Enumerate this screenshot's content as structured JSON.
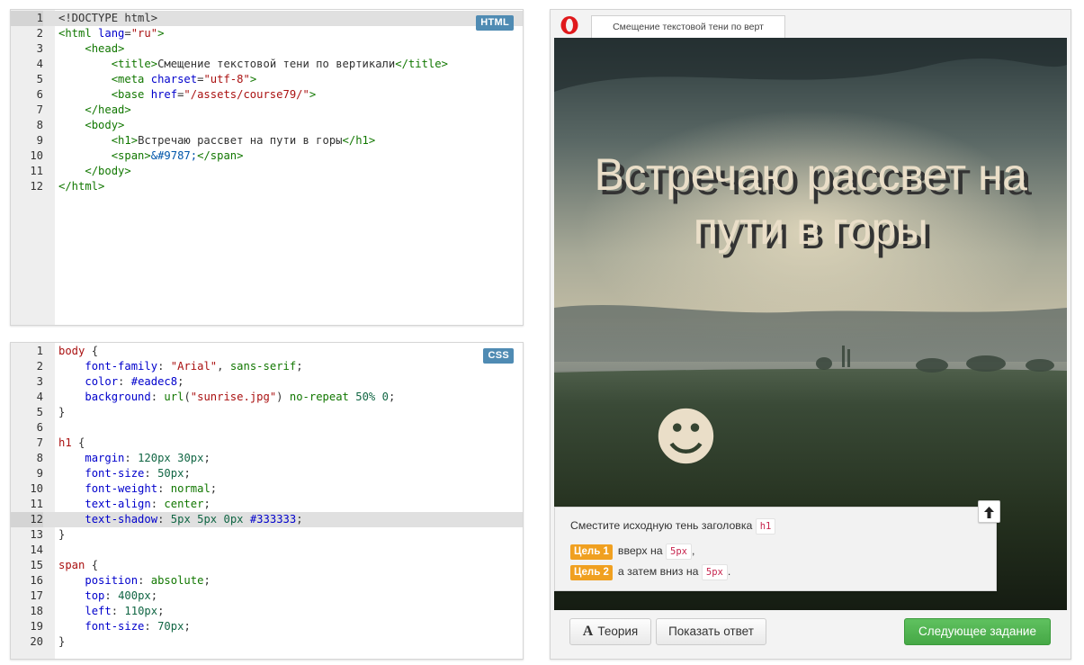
{
  "html_editor": {
    "badge": "HTML",
    "lines": [
      {
        "n": "1",
        "t": [
          [
            "plain",
            "<!DOCTYPE html>"
          ]
        ]
      },
      {
        "n": "2",
        "t": [
          [
            "tag",
            "<html"
          ],
          [
            "attr",
            " lang"
          ],
          [
            "plain",
            "="
          ],
          [
            "str",
            "\"ru\""
          ],
          [
            "tag",
            ">"
          ]
        ]
      },
      {
        "n": "3",
        "t": [
          [
            "plain",
            "    "
          ],
          [
            "tag",
            "<head>"
          ]
        ]
      },
      {
        "n": "4",
        "t": [
          [
            "plain",
            "        "
          ],
          [
            "tag",
            "<title>"
          ],
          [
            "plain",
            "Смещение текстовой тени по вертикали"
          ],
          [
            "tag",
            "</title>"
          ]
        ]
      },
      {
        "n": "5",
        "t": [
          [
            "plain",
            "        "
          ],
          [
            "tag",
            "<meta"
          ],
          [
            "attr",
            " charset"
          ],
          [
            "plain",
            "="
          ],
          [
            "str",
            "\"utf-8\""
          ],
          [
            "tag",
            ">"
          ]
        ]
      },
      {
        "n": "6",
        "t": [
          [
            "plain",
            "        "
          ],
          [
            "tag",
            "<base"
          ],
          [
            "attr",
            " href"
          ],
          [
            "plain",
            "="
          ],
          [
            "str",
            "\"/assets/course79/\""
          ],
          [
            "tag",
            ">"
          ]
        ]
      },
      {
        "n": "7",
        "t": [
          [
            "plain",
            "    "
          ],
          [
            "tag",
            "</head>"
          ]
        ]
      },
      {
        "n": "8",
        "t": [
          [
            "plain",
            "    "
          ],
          [
            "tag",
            "<body>"
          ]
        ]
      },
      {
        "n": "9",
        "t": [
          [
            "plain",
            "        "
          ],
          [
            "tag",
            "<h1>"
          ],
          [
            "plain",
            "Встречаю рассвет на пути в горы"
          ],
          [
            "tag",
            "</h1>"
          ]
        ]
      },
      {
        "n": "10",
        "t": [
          [
            "plain",
            "        "
          ],
          [
            "tag",
            "<span>"
          ],
          [
            "ent",
            "&#9787;"
          ],
          [
            "tag",
            "</span>"
          ]
        ]
      },
      {
        "n": "11",
        "t": [
          [
            "plain",
            "    "
          ],
          [
            "tag",
            "</body>"
          ]
        ]
      },
      {
        "n": "12",
        "t": [
          [
            "tag",
            "</html>"
          ]
        ]
      }
    ],
    "active_line": "1"
  },
  "css_editor": {
    "badge": "CSS",
    "lines": [
      {
        "n": "1",
        "t": [
          [
            "sel",
            "body"
          ],
          [
            "plain",
            " {"
          ]
        ]
      },
      {
        "n": "2",
        "t": [
          [
            "plain",
            "    "
          ],
          [
            "prop",
            "font-family"
          ],
          [
            "plain",
            ": "
          ],
          [
            "str",
            "\"Arial\""
          ],
          [
            "plain",
            ", "
          ],
          [
            "val",
            "sans-serif"
          ],
          [
            "plain",
            ";"
          ]
        ]
      },
      {
        "n": "3",
        "t": [
          [
            "plain",
            "    "
          ],
          [
            "prop",
            "color"
          ],
          [
            "plain",
            ": "
          ],
          [
            "attr",
            "#eadec8"
          ],
          [
            "plain",
            ";"
          ]
        ]
      },
      {
        "n": "4",
        "t": [
          [
            "plain",
            "    "
          ],
          [
            "prop",
            "background"
          ],
          [
            "plain",
            ": "
          ],
          [
            "val",
            "url"
          ],
          [
            "plain",
            "("
          ],
          [
            "str",
            "\"sunrise.jpg\""
          ],
          [
            "plain",
            ") "
          ],
          [
            "val",
            "no-repeat"
          ],
          [
            "plain",
            " "
          ],
          [
            "num",
            "50%"
          ],
          [
            "plain",
            " "
          ],
          [
            "num",
            "0"
          ],
          [
            "plain",
            ";"
          ]
        ]
      },
      {
        "n": "5",
        "t": [
          [
            "plain",
            "}"
          ]
        ]
      },
      {
        "n": "6",
        "t": [
          [
            "plain",
            ""
          ]
        ]
      },
      {
        "n": "7",
        "t": [
          [
            "sel",
            "h1"
          ],
          [
            "plain",
            " {"
          ]
        ]
      },
      {
        "n": "8",
        "t": [
          [
            "plain",
            "    "
          ],
          [
            "prop",
            "margin"
          ],
          [
            "plain",
            ": "
          ],
          [
            "num",
            "120px"
          ],
          [
            "plain",
            " "
          ],
          [
            "num",
            "30px"
          ],
          [
            "plain",
            ";"
          ]
        ]
      },
      {
        "n": "9",
        "t": [
          [
            "plain",
            "    "
          ],
          [
            "prop",
            "font-size"
          ],
          [
            "plain",
            ": "
          ],
          [
            "num",
            "50px"
          ],
          [
            "plain",
            ";"
          ]
        ]
      },
      {
        "n": "10",
        "t": [
          [
            "plain",
            "    "
          ],
          [
            "prop",
            "font-weight"
          ],
          [
            "plain",
            ": "
          ],
          [
            "val",
            "normal"
          ],
          [
            "plain",
            ";"
          ]
        ]
      },
      {
        "n": "11",
        "t": [
          [
            "plain",
            "    "
          ],
          [
            "prop",
            "text-align"
          ],
          [
            "plain",
            ": "
          ],
          [
            "val",
            "center"
          ],
          [
            "plain",
            ";"
          ]
        ]
      },
      {
        "n": "12",
        "t": [
          [
            "plain",
            "    "
          ],
          [
            "prop",
            "text-shadow"
          ],
          [
            "plain",
            ": "
          ],
          [
            "num",
            "5px"
          ],
          [
            "plain",
            " "
          ],
          [
            "num",
            "5px"
          ],
          [
            "plain",
            " "
          ],
          [
            "num",
            "0px"
          ],
          [
            "plain",
            " "
          ],
          [
            "attr",
            "#333333"
          ],
          [
            "plain",
            ";"
          ]
        ]
      },
      {
        "n": "13",
        "t": [
          [
            "plain",
            "}"
          ]
        ]
      },
      {
        "n": "14",
        "t": [
          [
            "plain",
            ""
          ]
        ]
      },
      {
        "n": "15",
        "t": [
          [
            "sel",
            "span"
          ],
          [
            "plain",
            " {"
          ]
        ]
      },
      {
        "n": "16",
        "t": [
          [
            "plain",
            "    "
          ],
          [
            "prop",
            "position"
          ],
          [
            "plain",
            ": "
          ],
          [
            "val",
            "absolute"
          ],
          [
            "plain",
            ";"
          ]
        ]
      },
      {
        "n": "17",
        "t": [
          [
            "plain",
            "    "
          ],
          [
            "prop",
            "top"
          ],
          [
            "plain",
            ": "
          ],
          [
            "num",
            "400px"
          ],
          [
            "plain",
            ";"
          ]
        ]
      },
      {
        "n": "18",
        "t": [
          [
            "plain",
            "    "
          ],
          [
            "prop",
            "left"
          ],
          [
            "plain",
            ": "
          ],
          [
            "num",
            "110px"
          ],
          [
            "plain",
            ";"
          ]
        ]
      },
      {
        "n": "19",
        "t": [
          [
            "plain",
            "    "
          ],
          [
            "prop",
            "font-size"
          ],
          [
            "plain",
            ": "
          ],
          [
            "num",
            "70px"
          ],
          [
            "plain",
            ";"
          ]
        ]
      },
      {
        "n": "20",
        "t": [
          [
            "plain",
            "}"
          ]
        ]
      }
    ],
    "active_line": "12"
  },
  "browser": {
    "tab_title": "Смещение текстовой тени по верт",
    "preview": {
      "heading": "Встречаю рассвет на пути в горы",
      "smiley": "☻"
    }
  },
  "task": {
    "instruction": "Сместите исходную тень заголовка",
    "instruction_code": "h1",
    "goals": [
      {
        "badge": "Цель 1",
        "text": "вверх на",
        "code": "5px",
        "after": ","
      },
      {
        "badge": "Цель 2",
        "text": "а затем вниз на",
        "code": "5px",
        "after": "."
      }
    ]
  },
  "buttons": {
    "theory_icon": "A",
    "theory": "Теория",
    "show_answer": "Показать ответ",
    "next": "Следующее задание"
  },
  "colors": {
    "accent_green": "#46a846",
    "goal_orange": "#f0a020",
    "badge_blue": "#4f8bb3",
    "heading_color": "#eadec8",
    "shadow_color": "#333333"
  },
  "icons": {
    "browser_logo": "opera-logo-icon",
    "collapse": "arrow-up-icon",
    "smiley": "smiley-face-icon"
  }
}
